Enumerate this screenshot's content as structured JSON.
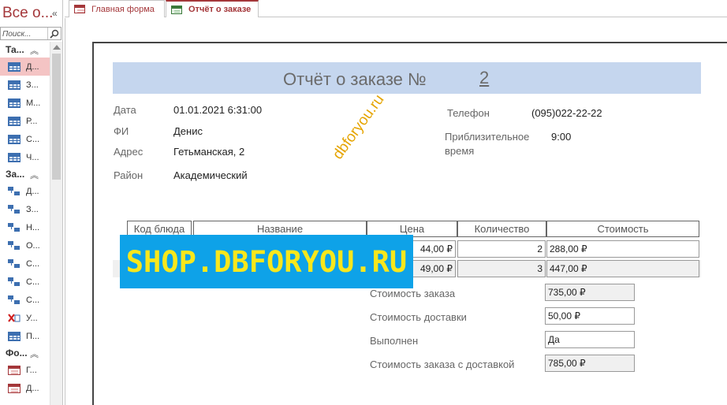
{
  "nav": {
    "title": "Все о...",
    "search_placeholder": "Поиск...",
    "groups": [
      {
        "label": "Та...",
        "items": [
          {
            "label": "Д...",
            "icon": "table-icon",
            "selected": true
          },
          {
            "label": "З...",
            "icon": "table-icon"
          },
          {
            "label": "М...",
            "icon": "table-icon"
          },
          {
            "label": "Р...",
            "icon": "table-icon"
          },
          {
            "label": "С...",
            "icon": "table-icon"
          },
          {
            "label": "Ч...",
            "icon": "table-icon"
          }
        ]
      },
      {
        "label": "За...",
        "items": [
          {
            "label": "Д...",
            "icon": "query-icon"
          },
          {
            "label": "З...",
            "icon": "query-icon"
          },
          {
            "label": "Н...",
            "icon": "query-icon"
          },
          {
            "label": "О...",
            "icon": "query-icon"
          },
          {
            "label": "С...",
            "icon": "query-icon"
          },
          {
            "label": "С...",
            "icon": "query-icon"
          },
          {
            "label": "С...",
            "icon": "query-icon"
          },
          {
            "label": "У...",
            "icon": "delete-query-icon"
          },
          {
            "label": "П...",
            "icon": "crosstab-icon"
          }
        ]
      },
      {
        "label": "Фо...",
        "items": [
          {
            "label": "Г...",
            "icon": "form-icon"
          },
          {
            "label": "Д...",
            "icon": "form-icon"
          }
        ]
      }
    ]
  },
  "tabs": [
    {
      "label": "Главная форма",
      "icon": "form-icon",
      "active": false
    },
    {
      "label": "Отчёт о заказе",
      "icon": "report-icon",
      "active": true
    }
  ],
  "report": {
    "title": "Отчёт о заказе №",
    "number": "2",
    "fields": {
      "date_label": "Дата",
      "date_value": "01.01.2021 6:31:00",
      "name_label": "ФИ",
      "name_value": "Денис",
      "address_label": "Адрес",
      "address_value": "Гетьманская, 2",
      "district_label": "Район",
      "district_value": "Академический",
      "phone_label": "Телефон",
      "phone_value": "(095)022-22-22",
      "eta_label_line1": "Приблизительное",
      "eta_label_line2": "время",
      "eta_value": "9:00"
    },
    "table": {
      "headers": [
        "Код блюда",
        "Название",
        "Цена",
        "Количество",
        "Стоимость"
      ],
      "rows": [
        {
          "price": "44,00 ₽",
          "qty": "2",
          "cost": "288,00 ₽"
        },
        {
          "price": "49,00 ₽",
          "qty": "3",
          "cost": "447,00 ₽"
        }
      ]
    },
    "totals": [
      {
        "label": "Стоимость заказа",
        "value": "735,00 ₽"
      },
      {
        "label": "Стоимость доставки",
        "value": "50,00 ₽"
      },
      {
        "label": "Выполнен",
        "value": "Да"
      },
      {
        "label": "Стоимость заказа с доставкой",
        "value": "785,00 ₽"
      }
    ]
  },
  "watermarks": {
    "diagonal": "dbforyou.ru",
    "banner": "SHOP.DBFORYOU.RU"
  }
}
